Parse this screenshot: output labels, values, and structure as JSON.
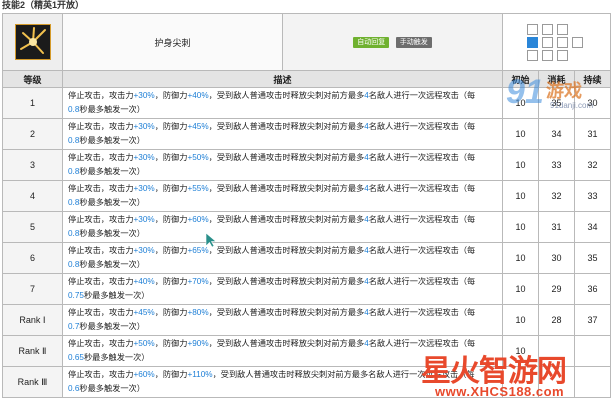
{
  "section_caption": "技能2（精英1开放）",
  "skill": {
    "name": "护身尖刺",
    "icon": "spike-burst-icon",
    "tags": [
      "自动回复",
      "手动触发"
    ],
    "tag_colors": [
      "#6fb12f",
      "#6d6d6d"
    ]
  },
  "range_grid": {
    "rows": [
      [
        "empty",
        "empty",
        "empty",
        "blank"
      ],
      [
        "self",
        "empty",
        "empty",
        "empty"
      ],
      [
        "empty",
        "empty",
        "empty",
        "blank"
      ]
    ],
    "self_color": "#2a86d8"
  },
  "headers": {
    "level": "等级",
    "desc": "描述",
    "initial": "初始",
    "cost": "消耗",
    "duration": "持续"
  },
  "levels": [
    {
      "level": "1",
      "atk": "+30%",
      "def": "+40%",
      "count": "4",
      "interval": "0.8",
      "initial": "10",
      "cost": "35",
      "duration": "30"
    },
    {
      "level": "2",
      "atk": "+30%",
      "def": "+45%",
      "count": "4",
      "interval": "0.8",
      "initial": "10",
      "cost": "34",
      "duration": "31"
    },
    {
      "level": "3",
      "atk": "+30%",
      "def": "+50%",
      "count": "4",
      "interval": "0.8",
      "initial": "10",
      "cost": "33",
      "duration": "32"
    },
    {
      "level": "4",
      "atk": "+30%",
      "def": "+55%",
      "count": "4",
      "interval": "0.8",
      "initial": "10",
      "cost": "32",
      "duration": "33"
    },
    {
      "level": "5",
      "atk": "+30%",
      "def": "+60%",
      "count": "4",
      "interval": "0.8",
      "initial": "10",
      "cost": "31",
      "duration": "34"
    },
    {
      "level": "6",
      "atk": "+30%",
      "def": "+65%",
      "count": "4",
      "interval": "0.8",
      "initial": "10",
      "cost": "30",
      "duration": "35"
    },
    {
      "level": "7",
      "atk": "+40%",
      "def": "+70%",
      "count": "4",
      "interval": "0.75",
      "initial": "10",
      "cost": "29",
      "duration": "36"
    },
    {
      "level": "Rank Ⅰ",
      "atk": "+45%",
      "def": "+80%",
      "count": "4",
      "interval": "0.7",
      "initial": "10",
      "cost": "28",
      "duration": "37"
    },
    {
      "level": "Rank Ⅱ",
      "atk": "+50%",
      "def": "+90%",
      "count": "4",
      "interval": "0.65",
      "initial": "10",
      "cost": "",
      "duration": ""
    },
    {
      "level": "Rank Ⅲ",
      "atk": "+60%",
      "def": "+110%",
      "count": "",
      "interval": "0.6",
      "initial": "",
      "cost": "",
      "duration": ""
    }
  ],
  "desc_parts": {
    "p1": "停止攻击，攻击力",
    "p2": "，防御力",
    "p3": "，受到敌人普通攻击时释放尖刺对前方最多",
    "p4": "名敌人进行一次远程攻击（每",
    "p5": "秒最多触发一次）"
  },
  "watermarks": {
    "site_logo_big": "91",
    "site_logo_cn": "游戏",
    "site_logo_url": "91danji.com",
    "brand_cn": "星火智游网",
    "brand_url": "www.XHCS188.com"
  }
}
